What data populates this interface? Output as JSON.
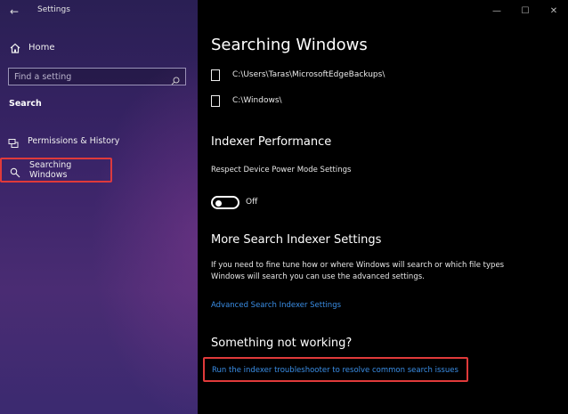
{
  "window": {
    "app_title": "Settings",
    "controls": {
      "minimize": "—",
      "maximize": "☐",
      "close": "✕"
    }
  },
  "sidebar": {
    "back_glyph": "←",
    "home_label": "Home",
    "search_placeholder": "Find a setting",
    "section_title": "Search",
    "items": [
      {
        "label": "Permissions & History",
        "icon": "permissions-icon"
      },
      {
        "label": "Searching Windows",
        "icon": "search-icon",
        "selected": true
      }
    ]
  },
  "main": {
    "title": "Searching Windows",
    "folders": [
      "C:\\Users\\Taras\\MicrosoftEdgeBackups\\",
      "C:\\Windows\\"
    ],
    "indexer_performance": {
      "heading": "Indexer Performance",
      "setting_label": "Respect Device Power Mode Settings",
      "toggle_state": "Off"
    },
    "more_settings": {
      "heading": "More Search Indexer Settings",
      "description": "If you need to fine tune how or where Windows will search or which file types Windows will search you can use the advanced settings.",
      "link": "Advanced Search Indexer Settings"
    },
    "not_working": {
      "heading": "Something not working?",
      "link": "Run the indexer troubleshooter to resolve common search issues"
    }
  },
  "colors": {
    "link": "#3a8ee6",
    "highlight": "#e03a3a",
    "sidebar_bg": "#3a2468"
  }
}
